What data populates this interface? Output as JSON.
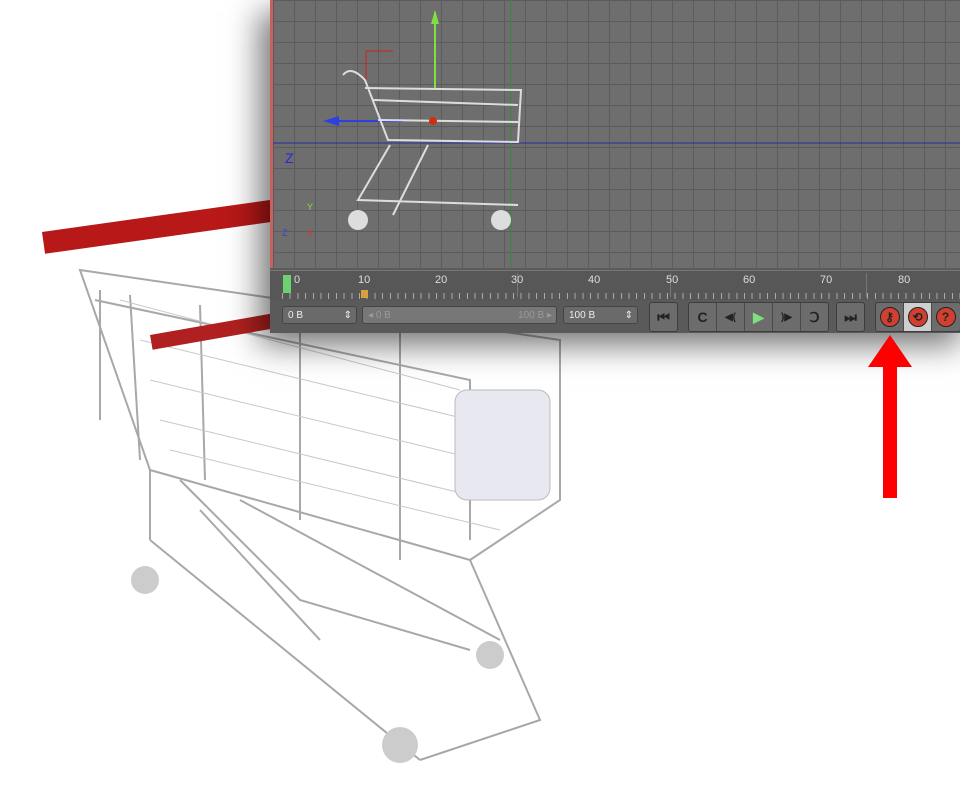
{
  "viewport": {
    "axis_labels": {
      "z_main": "Z",
      "y_small": "Y",
      "z_small": "Z",
      "x_small": "X"
    }
  },
  "timeline": {
    "ticks": [
      "0",
      "10",
      "20",
      "30",
      "40",
      "50",
      "60",
      "70",
      "80"
    ],
    "current_frame": 0
  },
  "controls": {
    "start_field": "0 B",
    "range_start": "0 B",
    "range_end": "100 B",
    "end_field": "100 B"
  },
  "buttons": {
    "goto_start": "⏮",
    "prev_key": "C",
    "prev_frame": "◀(",
    "play": "▶",
    "next_frame": ")▶",
    "next_key": "Ↄ",
    "goto_end": "⏭",
    "record": "⚷",
    "autokey": "⟲",
    "help": "?"
  },
  "colors": {
    "annotation_arrow": "#ff0000",
    "play": "#7ee07e"
  }
}
